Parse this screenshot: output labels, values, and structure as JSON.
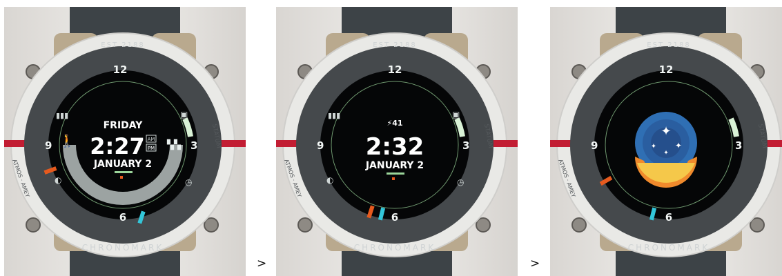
{
  "watch": {
    "brand_top": "EST 2188",
    "brand_bottom": "CHRONOMARK",
    "side_right": "STATUM",
    "side_left": "ATMOS · AMEY"
  },
  "dial": {
    "twelve": "12",
    "three": "3",
    "six": "6",
    "nine": "9"
  },
  "screens": [
    {
      "day": "FRIDAY",
      "time": "2:27",
      "am": "AM",
      "pm": "PM",
      "date": "JANUARY 2"
    },
    {
      "status": "⚡41",
      "time": "2:32",
      "date": "JANUARY 2"
    },
    {
      "logo": "starfield-emblem"
    }
  ],
  "separators": [
    ">",
    ">"
  ],
  "colors": {
    "strap": "#3d4347",
    "bezel": "#45494c",
    "gold": "#b9a98e",
    "white_case": "#e9e9e6",
    "red_stripe": "#c21d33",
    "accent_green": "#9bd59a",
    "accent_cyan": "#33c6d9",
    "accent_orange": "#e65a1e",
    "screen": "#050607",
    "logo_blue": "#2f6fb4",
    "logo_orange": "#f08a2c"
  }
}
